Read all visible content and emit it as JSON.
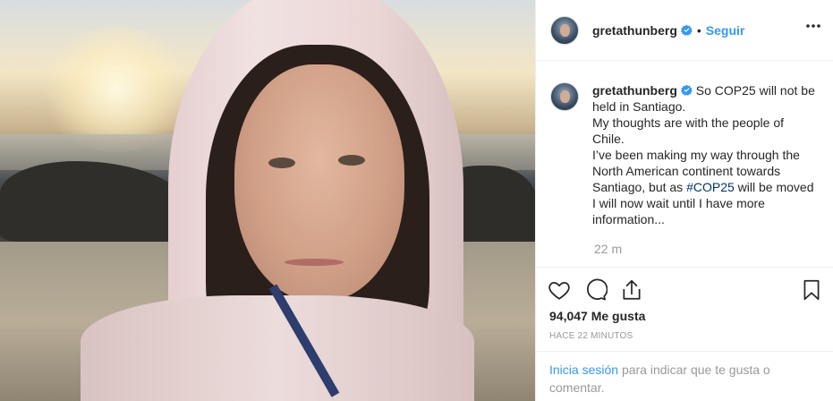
{
  "post": {
    "username": "gretathunberg",
    "follow_label": "Seguir",
    "dot": "•",
    "caption_lines": [
      "So COP25 will not be held in Santiago.",
      "My thoughts are with the people of Chile.",
      "I’ve been making my way through the North American continent towards Santiago, but as"
    ],
    "hashtag": "#COP25",
    "caption_tail": "will be moved I will now wait until I have more information...",
    "time_ago": "22 m",
    "likes": "94,047 Me gusta",
    "posted": "HACE 22 MINUTOS",
    "login_link": "Inicia sesión",
    "login_text": "para indicar que te gusta o comentar."
  },
  "icons": {
    "verified": "verified-badge-icon",
    "more": "more-options-icon",
    "like": "heart-icon",
    "comment": "comment-icon",
    "share": "share-icon",
    "save": "bookmark-icon"
  },
  "colors": {
    "link": "#3897f0",
    "hashtag": "#003569",
    "muted": "#999999",
    "text": "#262626"
  }
}
